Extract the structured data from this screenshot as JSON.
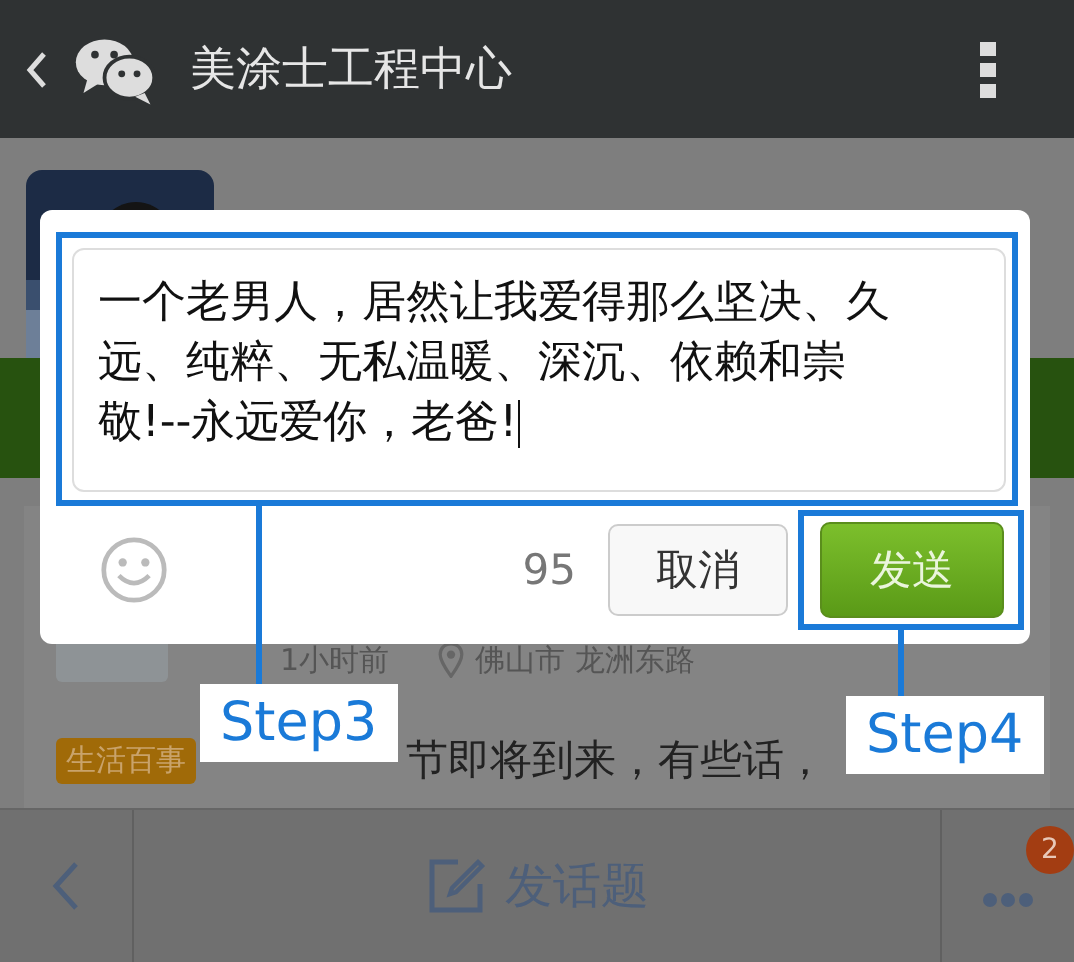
{
  "header": {
    "title": "美涂士工程中心"
  },
  "post": {
    "time": "1小时前",
    "location": "佛山市 龙洲东路",
    "tag": "生活百事",
    "text": "节即将到来，有些话，"
  },
  "dialog": {
    "value": "一个老男人，居然让我爱得那么坚决、久远、纯粹、无私温暖、深沉、依赖和崇敬!--永远爱你，老爸!",
    "counter": "95",
    "buttons": [
      {
        "label": "取消",
        "kind": "secondary"
      },
      {
        "label": "发送",
        "kind": "primary"
      }
    ]
  },
  "annotations": [
    {
      "label": "Step3"
    },
    {
      "label": "Step4"
    }
  ],
  "bottom_bar": {
    "action": "发话题",
    "badge": "2"
  }
}
